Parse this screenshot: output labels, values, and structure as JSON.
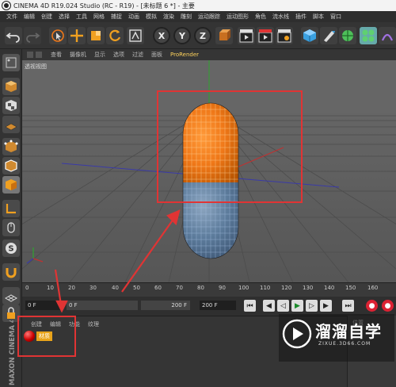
{
  "window": {
    "title": "CINEMA 4D R19.024 Studio (RC - R19) - [未标题 6 *] - 主要"
  },
  "menubar": {
    "items": [
      "文件",
      "编辑",
      "创建",
      "选择",
      "工具",
      "网格",
      "捕捉",
      "动画",
      "模拟",
      "渲染",
      "雕刻",
      "运动跟踪",
      "运动图形",
      "角色",
      "流水线",
      "插件",
      "脚本",
      "窗口"
    ]
  },
  "toolbar": {
    "axis_x": "X",
    "axis_y": "Y",
    "axis_z": "Z"
  },
  "viewport": {
    "menu": [
      "查看",
      "摄像机",
      "显示",
      "选项",
      "过滤",
      "面板"
    ],
    "prorender": "ProRender",
    "label": "透视视图"
  },
  "timeline": {
    "ticks": [
      "0",
      "10",
      "20",
      "30",
      "40",
      "50",
      "60",
      "70",
      "80",
      "90",
      "100",
      "110",
      "120",
      "130",
      "140",
      "150",
      "160"
    ]
  },
  "transport": {
    "current_frame": "0 F",
    "range_start": "0 F",
    "range_end": "200 F",
    "max_frame": "200 F"
  },
  "material_panel": {
    "menu": [
      "创建",
      "编辑",
      "功能",
      "纹理"
    ],
    "material_name": "材质"
  },
  "coordinates": {
    "label": "位置"
  },
  "side_logo": {
    "text": "MAXON CINEMA 4D"
  },
  "watermark": {
    "title": "溜溜自学",
    "subtitle": "ZIXUE.3D66.COM"
  },
  "colors": {
    "highlight_box": "#e03434",
    "annotation_arrow": "#e03434",
    "selected_orange": "#f07818",
    "capsule_blue": "#5d7c9c"
  }
}
